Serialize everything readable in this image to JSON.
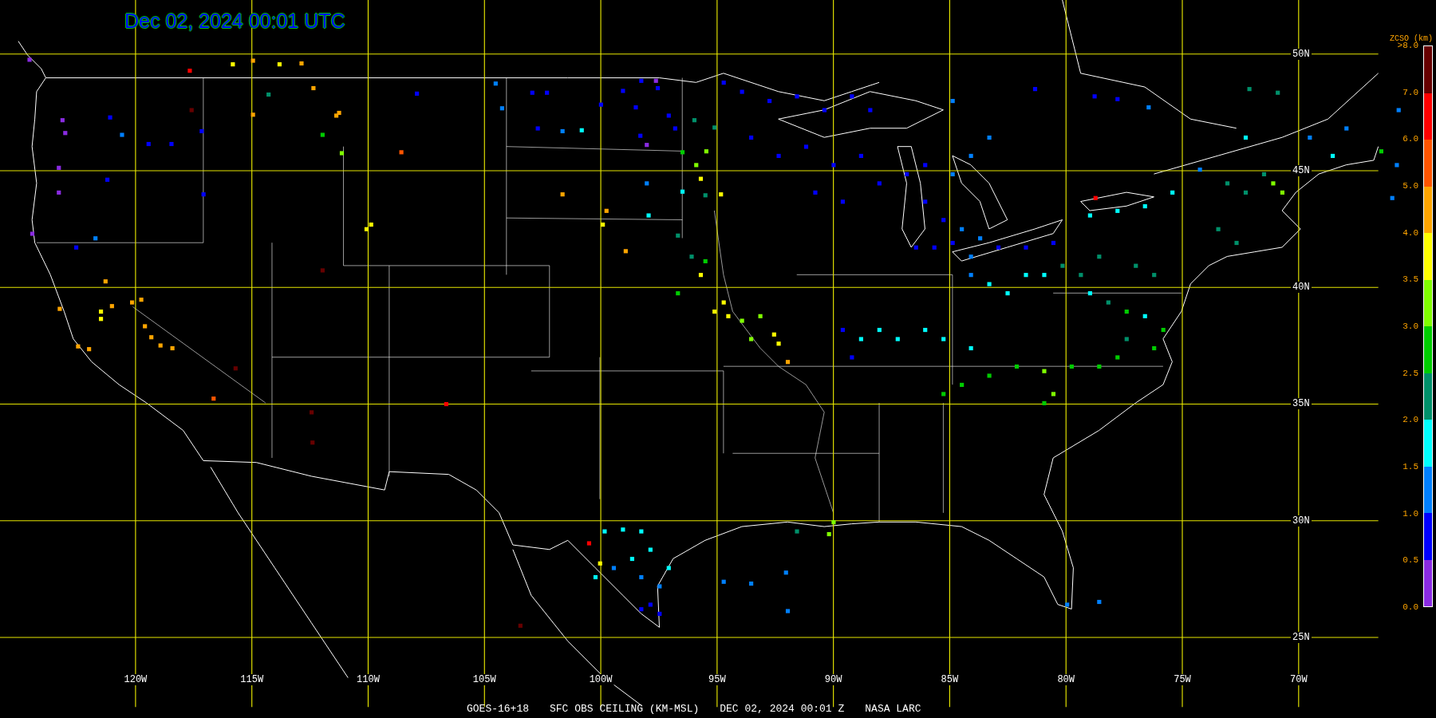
{
  "title": "Dec 02, 2024 00:01 UTC",
  "map": {
    "lat_labels": [
      "50N",
      "45N",
      "40N",
      "35N",
      "30N",
      "25N"
    ],
    "lon_labels": [
      "120W",
      "115W",
      "110W",
      "105W",
      "100W",
      "95W",
      "90W",
      "85W",
      "80W",
      "75W",
      "70W"
    ]
  },
  "legend": {
    "title": "ZCSO (km)",
    "labels": [
      ">8.0",
      "7.0",
      "6.0",
      "5.0",
      "4.0",
      "3.5",
      "3.0",
      "2.5",
      "2.0",
      "1.5",
      "1.0",
      "0.5",
      "0.0"
    ],
    "bands": [
      {
        "color": "#660000"
      },
      {
        "color": "#ff0000"
      },
      {
        "color": "#ff5500"
      },
      {
        "color": "#ffa500"
      },
      {
        "color": "#ffff00"
      },
      {
        "color": "#80ff00"
      },
      {
        "color": "#00cc00"
      },
      {
        "color": "#00906a"
      },
      {
        "color": "#00ffff"
      },
      {
        "color": "#0080ff"
      },
      {
        "color": "#0000ff"
      },
      {
        "color": "#8a2be2"
      }
    ]
  },
  "caption": [
    "GOES-16+18",
    "SFC OBS CEILING (KM-MSL)",
    "DEC 02, 2024 00:01 Z",
    "NASA LARC"
  ]
}
